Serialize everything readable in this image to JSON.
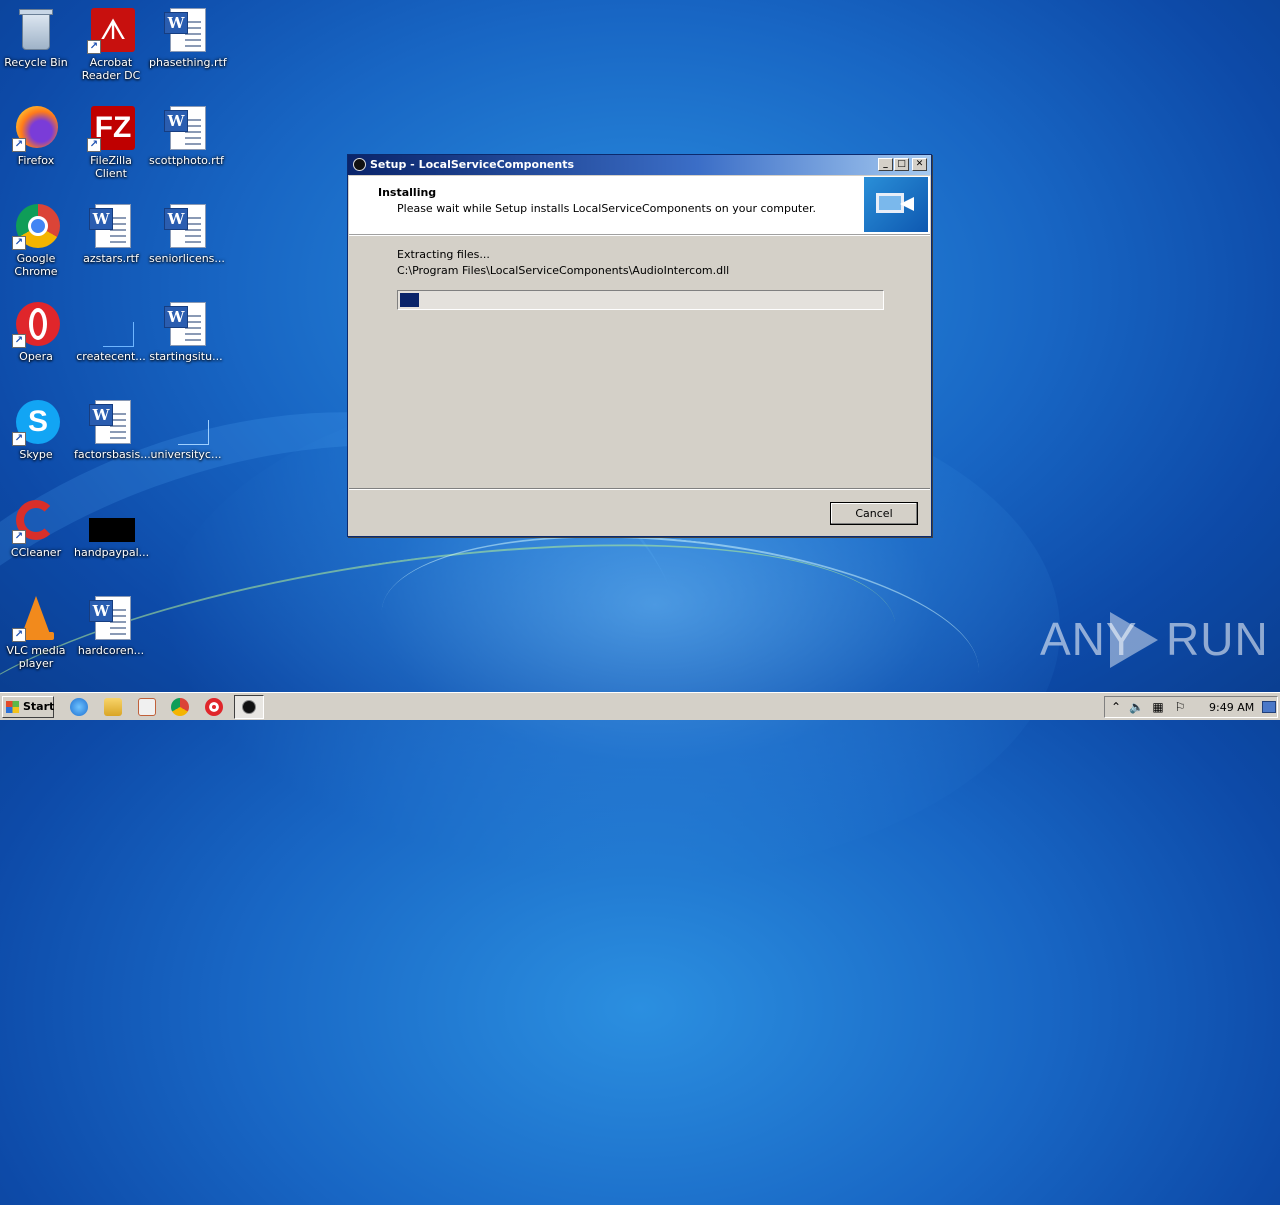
{
  "desktop": {
    "icons": [
      {
        "label": "Recycle Bin"
      },
      {
        "label": "Acrobat Reader DC"
      },
      {
        "label": "phasething.rtf"
      },
      {
        "label": "Firefox"
      },
      {
        "label": "FileZilla Client"
      },
      {
        "label": "scottphoto.rtf"
      },
      {
        "label": "Google Chrome"
      },
      {
        "label": "azstars.rtf"
      },
      {
        "label": "seniorlicens..."
      },
      {
        "label": "Opera"
      },
      {
        "label": "createcent..."
      },
      {
        "label": "startingsitu..."
      },
      {
        "label": "Skype"
      },
      {
        "label": "factorsbasis..."
      },
      {
        "label": "universityc..."
      },
      {
        "label": "CCleaner"
      },
      {
        "label": "handpaypal..."
      },
      {
        "label": "VLC media player"
      },
      {
        "label": "hardcoren..."
      }
    ]
  },
  "window": {
    "title": "Setup - LocalServiceComponents",
    "minimize": "_",
    "maximize": "□",
    "close": "✕",
    "header_title": "Installing",
    "header_subtitle": "Please wait while Setup installs LocalServiceComponents on your computer.",
    "status": "Extracting files...",
    "current_file": "C:\\Program Files\\LocalServiceComponents\\AudioIntercom.dll",
    "progress_fraction": 0.04,
    "cancel_label": "Cancel"
  },
  "taskbar": {
    "start_label": "Start",
    "clock": "9:49 AM",
    "tray_expand": "⌃"
  },
  "watermark": {
    "text_left": "ANY",
    "text_right": "RUN"
  },
  "colors": {
    "title_active": "#0a246a",
    "progress_fill": "#0a246a",
    "dialog_face": "#d4d0c8"
  }
}
